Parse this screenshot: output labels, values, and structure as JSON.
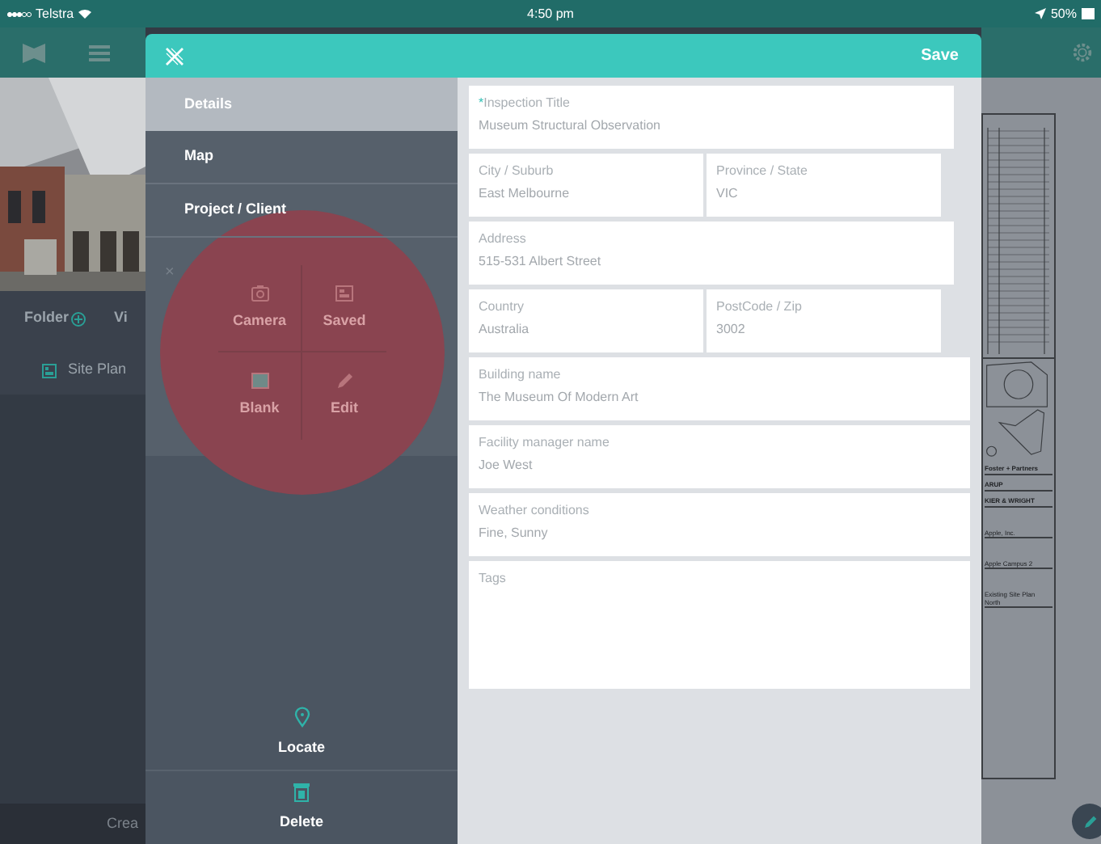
{
  "status_bar": {
    "carrier": "Telstra",
    "time": "4:50 pm",
    "battery": "50%"
  },
  "background": {
    "folder_label": "Folder",
    "tab_2": "Vi",
    "list_items": [
      {
        "label": "Site Plan"
      }
    ],
    "bottom_button": "Crea",
    "drawing_texts": [
      {
        "kind": "logo",
        "text": "Foster + Partners"
      },
      {
        "kind": "logo",
        "text": "ARUP"
      },
      {
        "kind": "logo",
        "text": "KIER & WRIGHT"
      },
      {
        "kind": "note",
        "text": "Apple, Inc."
      },
      {
        "kind": "note",
        "text": "Apple Campus 2"
      },
      {
        "kind": "note",
        "text": "Existing Site Plan North"
      }
    ]
  },
  "modal": {
    "save": "Save",
    "nav": [
      {
        "label": "Details",
        "selected": true
      },
      {
        "label": "Map",
        "selected": false
      },
      {
        "label": "Project / Client",
        "selected": false
      }
    ],
    "popup_close": "×",
    "radial_menu": [
      {
        "label": "Camera",
        "kind": "camera"
      },
      {
        "label": "Saved",
        "kind": "gallery"
      },
      {
        "label": "Blank",
        "kind": "blank"
      },
      {
        "label": "Edit",
        "kind": "pencil"
      }
    ],
    "actions": [
      {
        "label": "Locate",
        "kind": "pin"
      },
      {
        "label": "Delete",
        "kind": "trash"
      }
    ],
    "form": [
      {
        "kind": "single",
        "fields": [
          {
            "marker": "*",
            "label": "Inspection Title",
            "value": "Museum Structural Observation"
          }
        ]
      },
      {
        "kind": "pair",
        "fields": [
          {
            "label": "City / Suburb",
            "value": "East Melbourne"
          },
          {
            "label": "Province / State",
            "value": "VIC"
          }
        ]
      },
      {
        "kind": "single",
        "fields": [
          {
            "label": "Address",
            "value": "515-531 Albert Street"
          }
        ]
      },
      {
        "kind": "pair",
        "fields": [
          {
            "label": "Country",
            "value": "Australia"
          },
          {
            "label": "PostCode / Zip",
            "value": "3002"
          }
        ]
      },
      {
        "kind": "wide",
        "fields": [
          {
            "label": "Building name",
            "value": "The Museum Of Modern Art"
          }
        ]
      },
      {
        "kind": "wide",
        "fields": [
          {
            "label": "Facility manager name",
            "value": "Joe West"
          }
        ]
      },
      {
        "kind": "wide",
        "fields": [
          {
            "label": "Weather conditions",
            "value": "Fine, Sunny"
          }
        ]
      },
      {
        "kind": "area",
        "fields": [
          {
            "label": "Tags"
          }
        ]
      }
    ]
  }
}
